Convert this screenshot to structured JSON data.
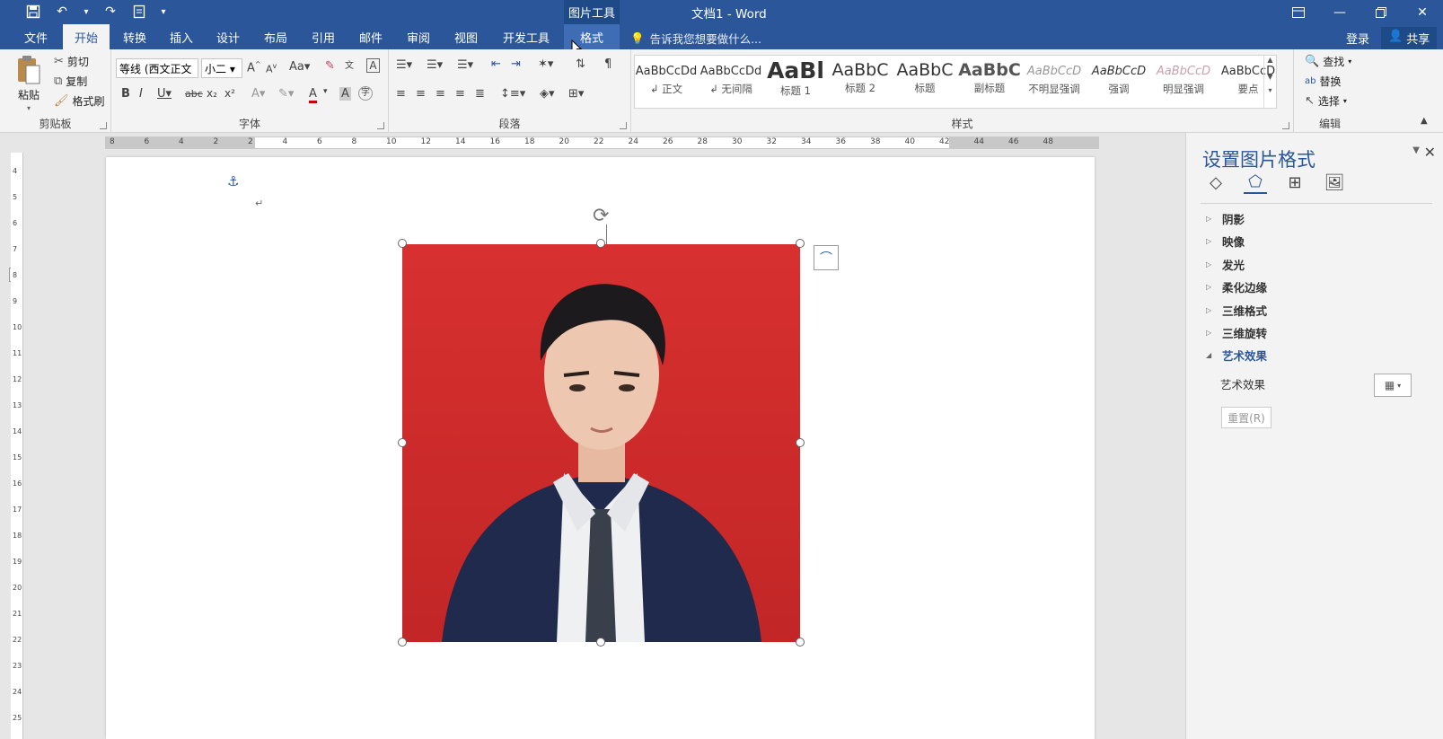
{
  "titlebar": {
    "title": "文档1 - Word",
    "context_tab": "图片工具"
  },
  "tabs": [
    {
      "label": "文件"
    },
    {
      "label": "开始"
    },
    {
      "label": "转换"
    },
    {
      "label": "插入"
    },
    {
      "label": "设计"
    },
    {
      "label": "布局"
    },
    {
      "label": "引用"
    },
    {
      "label": "邮件"
    },
    {
      "label": "审阅"
    },
    {
      "label": "视图"
    },
    {
      "label": "开发工具"
    },
    {
      "label": "格式"
    }
  ],
  "tellme": "告诉我您想要做什么...",
  "login": "登录",
  "share": "共享",
  "clipboard": {
    "paste": "粘贴",
    "cut": "剪切",
    "copy": "复制",
    "painter": "格式刷",
    "label": "剪贴板"
  },
  "font": {
    "name": "等线 (西文正文",
    "size": "小二",
    "label": "字体"
  },
  "paragraph": {
    "label": "段落"
  },
  "styles": {
    "label": "样式",
    "items": [
      {
        "preview": "AaBbCcDd",
        "name": "↲ 正文"
      },
      {
        "preview": "AaBbCcDd",
        "name": "↲ 无间隔"
      },
      {
        "preview": "AaBl",
        "name": "标题 1"
      },
      {
        "preview": "AaBbC",
        "name": "标题 2"
      },
      {
        "preview": "AaBbC",
        "name": "标题"
      },
      {
        "preview": "AaBbC",
        "name": "副标题"
      },
      {
        "preview": "AaBbCcD",
        "name": "不明显强调"
      },
      {
        "preview": "AaBbCcD",
        "name": "强调"
      },
      {
        "preview": "AaBbCcD",
        "name": "明显强调"
      },
      {
        "preview": "AaBbCcD",
        "name": "要点"
      }
    ]
  },
  "editing": {
    "find": "查找",
    "replace": "替换",
    "select": "选择",
    "label": "编辑"
  },
  "ruler": {
    "h_ticks": [
      "8",
      "6",
      "4",
      "2",
      "2",
      "4",
      "6",
      "8",
      "10",
      "12",
      "14",
      "16",
      "18",
      "20",
      "22",
      "24",
      "26",
      "28",
      "30",
      "32",
      "34",
      "36",
      "38",
      "40",
      "42",
      "44",
      "46",
      "48"
    ],
    "v_ticks": [
      "4",
      "5",
      "6",
      "7",
      "8",
      "9",
      "10",
      "11",
      "12",
      "13",
      "14",
      "15",
      "16",
      "17",
      "18",
      "19",
      "20",
      "21",
      "22",
      "23",
      "24",
      "25"
    ]
  },
  "panel": {
    "title": "设置图片格式",
    "items": [
      {
        "label": "阴影"
      },
      {
        "label": "映像"
      },
      {
        "label": "发光"
      },
      {
        "label": "柔化边缘"
      },
      {
        "label": "三维格式"
      },
      {
        "label": "三维旋转"
      },
      {
        "label": "艺术效果"
      }
    ],
    "art_effects_label": "艺术效果",
    "reset": "重置(R)"
  },
  "colors": {
    "brand": "#2b579a",
    "photo_bg": "#d32f2f"
  }
}
